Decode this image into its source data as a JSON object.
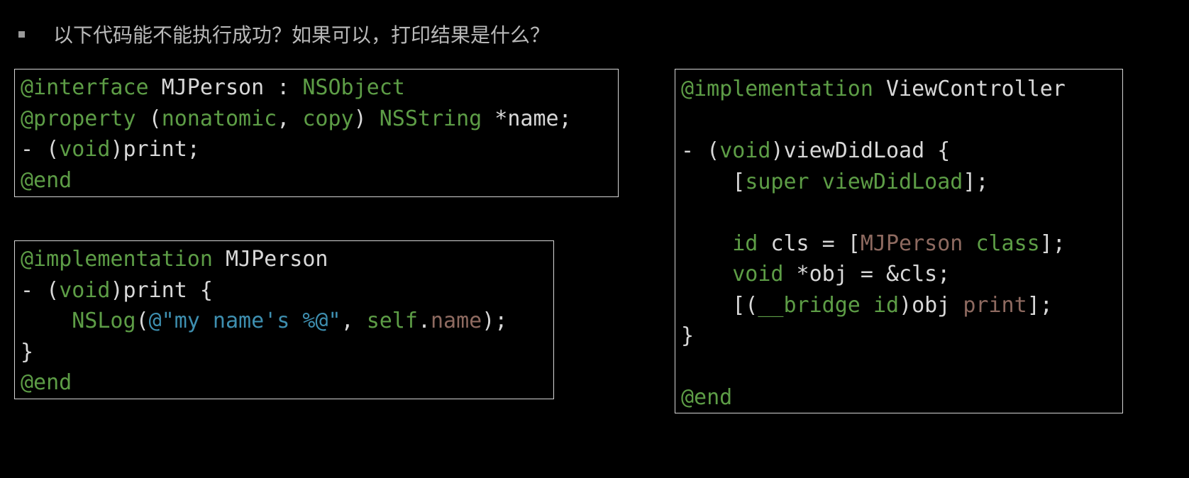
{
  "question": {
    "text": "以下代码能不能执行成功？如果可以，打印结果是什么？"
  },
  "colors": {
    "background": "#000000",
    "keyword": "#5d9d46",
    "string": "#3e8fb0",
    "method": "#8e6a60",
    "plain": "#d8d8d8",
    "border": "#d6d6d6"
  },
  "code_blocks": [
    {
      "name": "interface",
      "lines": [
        [
          [
            "kw",
            "@interface"
          ],
          [
            "plain",
            " MJPerson : "
          ],
          [
            "kw",
            "NSObject"
          ]
        ],
        [
          [
            "kw",
            "@property"
          ],
          [
            "plain",
            " ("
          ],
          [
            "kw",
            "nonatomic"
          ],
          [
            "plain",
            ", "
          ],
          [
            "kw",
            "copy"
          ],
          [
            "plain",
            ") "
          ],
          [
            "kw",
            "NSString"
          ],
          [
            "plain",
            " *name;"
          ]
        ],
        [
          [
            "plain",
            "- ("
          ],
          [
            "kw",
            "void"
          ],
          [
            "plain",
            ")print;"
          ]
        ],
        [
          [
            "kw",
            "@end"
          ]
        ]
      ]
    },
    {
      "name": "implementation",
      "lines": [
        [
          [
            "kw",
            "@implementation"
          ],
          [
            "plain",
            " MJPerson"
          ]
        ],
        [
          [
            "plain",
            "- ("
          ],
          [
            "kw",
            "void"
          ],
          [
            "plain",
            ")print {"
          ]
        ],
        [
          [
            "plain",
            "    "
          ],
          [
            "kw",
            "NSLog"
          ],
          [
            "plain",
            "("
          ],
          [
            "str",
            "@\"my name's %@\""
          ],
          [
            "plain",
            ", "
          ],
          [
            "kw",
            "self"
          ],
          [
            "plain",
            "."
          ],
          [
            "meth",
            "name"
          ],
          [
            "plain",
            ");"
          ]
        ],
        [
          [
            "plain",
            "}"
          ]
        ],
        [
          [
            "kw",
            "@end"
          ]
        ]
      ]
    },
    {
      "name": "viewcontroller",
      "lines": [
        [
          [
            "kw",
            "@implementation"
          ],
          [
            "plain",
            " ViewController"
          ]
        ],
        [
          [
            "plain",
            ""
          ]
        ],
        [
          [
            "plain",
            "- ("
          ],
          [
            "kw",
            "void"
          ],
          [
            "plain",
            ")viewDidLoad {"
          ]
        ],
        [
          [
            "plain",
            "    ["
          ],
          [
            "kw",
            "super"
          ],
          [
            "plain",
            " "
          ],
          [
            "kw",
            "viewDidLoad"
          ],
          [
            "plain",
            "];"
          ]
        ],
        [
          [
            "plain",
            ""
          ]
        ],
        [
          [
            "plain",
            "    "
          ],
          [
            "kw",
            "id"
          ],
          [
            "plain",
            " cls = ["
          ],
          [
            "meth",
            "MJPerson"
          ],
          [
            "plain",
            " "
          ],
          [
            "kw",
            "class"
          ],
          [
            "plain",
            "];"
          ]
        ],
        [
          [
            "plain",
            "    "
          ],
          [
            "kw",
            "void"
          ],
          [
            "plain",
            " *obj = &cls;"
          ]
        ],
        [
          [
            "plain",
            "    [("
          ],
          [
            "kw",
            "__bridge"
          ],
          [
            "plain",
            " "
          ],
          [
            "kw",
            "id"
          ],
          [
            "plain",
            ")obj "
          ],
          [
            "meth",
            "print"
          ],
          [
            "plain",
            "];"
          ]
        ],
        [
          [
            "plain",
            "}"
          ]
        ],
        [
          [
            "plain",
            ""
          ]
        ],
        [
          [
            "kw",
            "@end"
          ]
        ]
      ]
    }
  ]
}
